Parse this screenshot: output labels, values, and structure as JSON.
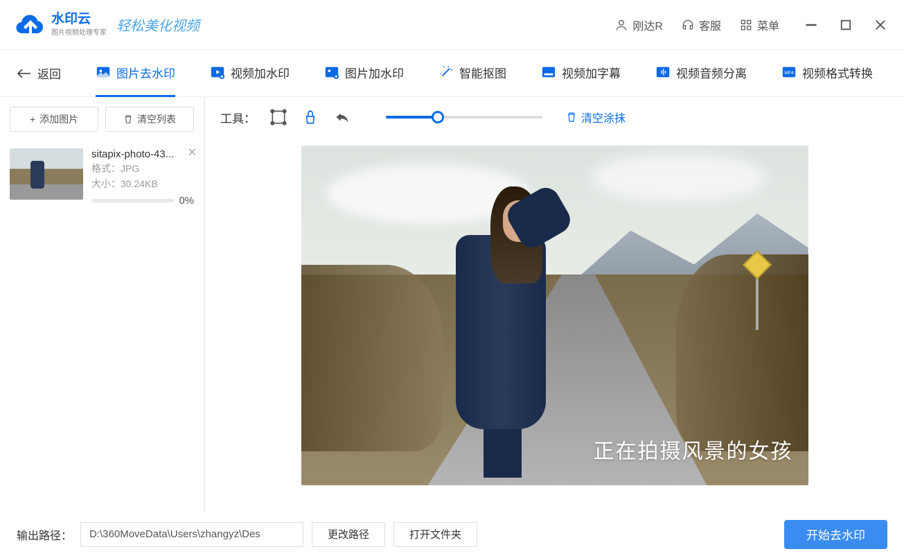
{
  "header": {
    "logo_title": "水印云",
    "logo_sub": "图片视频处理专家",
    "slogan": "轻松美化视频",
    "user_label": "刚达R",
    "support_label": "客服",
    "menu_label": "菜单"
  },
  "nav": {
    "back_label": "返回",
    "tabs": [
      {
        "label": "图片去水印",
        "active": true
      },
      {
        "label": "视频加水印",
        "active": false
      },
      {
        "label": "图片加水印",
        "active": false
      },
      {
        "label": "智能抠图",
        "active": false
      },
      {
        "label": "视频加字幕",
        "active": false
      },
      {
        "label": "视频音频分离",
        "active": false
      },
      {
        "label": "视频格式转换",
        "active": false
      }
    ]
  },
  "sidebar": {
    "add_label": "添加图片",
    "clear_label": "清空列表",
    "file": {
      "name": "sitapix-photo-43...",
      "format_label": "格式：",
      "format_value": "JPG",
      "size_label": "大小：",
      "size_value": "30.24KB",
      "progress_text": "0%"
    }
  },
  "toolbar": {
    "label": "工具：",
    "clear_smear_label": "清空涂抹",
    "slider_percent": 33
  },
  "canvas": {
    "watermark_text": "正在拍摄风景的女孩"
  },
  "footer": {
    "path_label": "输出路径：",
    "path_value": "D:\\360MoveData\\Users\\zhangyz\\Des",
    "change_path_label": "更改路径",
    "open_folder_label": "打开文件夹",
    "start_label": "开始去水印"
  }
}
